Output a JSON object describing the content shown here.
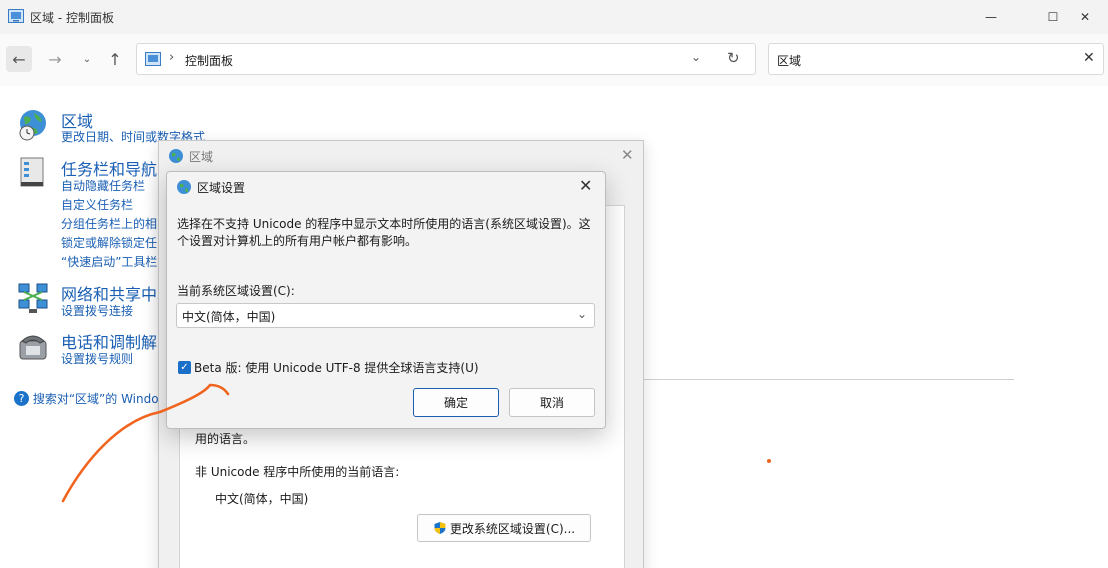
{
  "window": {
    "title": "区域 - 控制面板",
    "min_glyph": "—",
    "max_glyph": "☐",
    "close_glyph": "✕"
  },
  "nav": {
    "back_glyph": "←",
    "forward_glyph": "→",
    "history_glyph": "⌄",
    "up_glyph": "↑"
  },
  "address": {
    "chevron": "›",
    "path": "控制面板",
    "dropdown_glyph": "⌄",
    "refresh_glyph": "↻"
  },
  "search": {
    "value": "区域",
    "clear_glyph": "✕"
  },
  "categories": [
    {
      "title": "区域",
      "links": [
        "更改日期、时间或数字格式"
      ]
    },
    {
      "title": "任务栏和导航",
      "links": [
        "自动隐藏任务栏",
        "自定义任务栏",
        "分组任务栏上的相",
        "锁定或解除锁定任",
        "“快速启动”工具栏"
      ]
    },
    {
      "title": "网络和共享中心",
      "links": [
        "设置拨号连接"
      ]
    },
    {
      "title": "电话和调制解",
      "links": [
        "设置拨号规则"
      ]
    }
  ],
  "help": {
    "glyph": "?",
    "text": "搜索对“区域”的 Windows"
  },
  "region_dialog": {
    "title": "区域",
    "close_glyph": "✕",
    "partial_text": "用的语言。",
    "current_label": "非 Unicode 程序中所使用的当前语言:",
    "current_value": "中文(简体，中国)",
    "change_button": "更改系统区域设置(C)..."
  },
  "settings_dialog": {
    "title": "区域设置",
    "close_glyph": "✕",
    "description": "选择在不支持 Unicode 的程序中显示文本时所使用的语言(系统区域设置)。这个设置对计算机上的所有用户帐户都有影响。",
    "locale_label": "当前系统区域设置(C):",
    "locale_value": "中文(简体，中国)",
    "dropdown_glyph": "⌄",
    "beta_checked_glyph": "✓",
    "beta_label": "Beta 版: 使用 Unicode UTF-8 提供全球语言支持(U)",
    "ok_label": "确定",
    "cancel_label": "取消"
  },
  "colors": {
    "link": "#1a5fb4",
    "accent": "#1a6fc9",
    "annotation": "#f0641e"
  }
}
